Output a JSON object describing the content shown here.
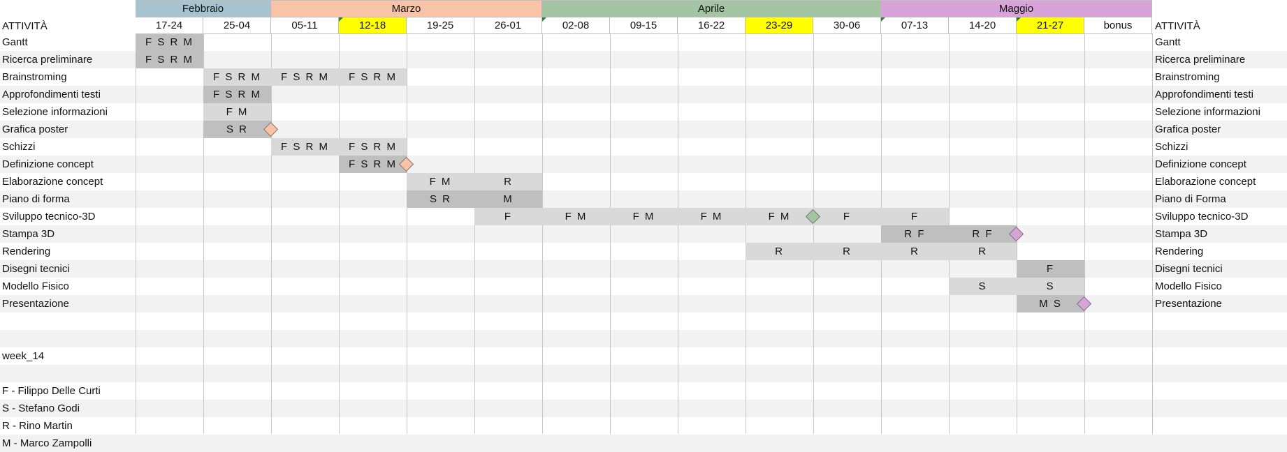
{
  "header_label": "ATTIVITÀ",
  "months": [
    {
      "name": "Febbraio",
      "color": "#a6c3cf",
      "start": 0,
      "span": 2
    },
    {
      "name": "Marzo",
      "color": "#f8c3a6",
      "start": 2,
      "span": 4
    },
    {
      "name": "Aprile",
      "color": "#a4c5a4",
      "start": 6,
      "span": 5
    },
    {
      "name": "Maggio",
      "color": "#d8a3d8",
      "start": 11,
      "span": 4
    }
  ],
  "weeks": [
    {
      "label": "17-24",
      "highlight": false,
      "flag": false
    },
    {
      "label": "25-04",
      "highlight": false,
      "flag": false
    },
    {
      "label": "05-11",
      "highlight": false,
      "flag": false
    },
    {
      "label": "12-18",
      "highlight": true,
      "flag": true
    },
    {
      "label": "19-25",
      "highlight": false,
      "flag": false
    },
    {
      "label": "26-01",
      "highlight": false,
      "flag": false
    },
    {
      "label": "02-08",
      "highlight": false,
      "flag": true
    },
    {
      "label": "09-15",
      "highlight": false,
      "flag": false
    },
    {
      "label": "16-22",
      "highlight": false,
      "flag": false
    },
    {
      "label": "23-29",
      "highlight": true,
      "flag": false
    },
    {
      "label": "30-06",
      "highlight": false,
      "flag": false
    },
    {
      "label": "07-13",
      "highlight": false,
      "flag": true
    },
    {
      "label": "14-20",
      "highlight": false,
      "flag": false
    },
    {
      "label": "21-27",
      "highlight": true,
      "flag": true
    },
    {
      "label": "bonus",
      "highlight": false,
      "flag": false
    }
  ],
  "colors": {
    "highlight": "#ffff00",
    "bar_light": "#d9d9d9",
    "bar_dark": "#bfbfbf",
    "flag": "#2e7d32"
  },
  "activities": [
    {
      "name": "Gantt",
      "right": "Gantt",
      "cells": [
        {
          "w": 0,
          "t": "FSRM",
          "shade": "dark"
        }
      ],
      "milestones": []
    },
    {
      "name": "Ricerca preliminare",
      "right": "Ricerca preliminare",
      "cells": [
        {
          "w": 0,
          "t": "FSRM",
          "shade": "dark"
        }
      ],
      "milestones": []
    },
    {
      "name": "Brainstroming",
      "right": "Brainstroming",
      "cells": [
        {
          "w": 1,
          "t": "FSRM",
          "shade": "light"
        },
        {
          "w": 2,
          "t": "FSRM",
          "shade": "light"
        },
        {
          "w": 3,
          "t": "FSRM",
          "shade": "light"
        }
      ],
      "milestones": []
    },
    {
      "name": "Approfondimenti testi",
      "right": "Approfondimenti testi",
      "cells": [
        {
          "w": 1,
          "t": "FSRM",
          "shade": "dark"
        }
      ],
      "milestones": []
    },
    {
      "name": "Selezione informazioni",
      "right": "Selezione informazioni",
      "cells": [
        {
          "w": 1,
          "t": "FM",
          "shade": "light"
        }
      ],
      "milestones": []
    },
    {
      "name": "Grafica poster",
      "right": "Grafica poster",
      "cells": [
        {
          "w": 1,
          "t": "SR",
          "shade": "dark"
        }
      ],
      "milestones": [
        {
          "w": 2,
          "color": "#f8c3a6"
        }
      ]
    },
    {
      "name": "Schizzi",
      "right": "Schizzi",
      "cells": [
        {
          "w": 2,
          "t": "FSRM",
          "shade": "light"
        },
        {
          "w": 3,
          "t": "FSRM",
          "shade": "light"
        }
      ],
      "milestones": []
    },
    {
      "name": "Definizione concept",
      "right": "Definizione concept",
      "cells": [
        {
          "w": 3,
          "t": "FSRM",
          "shade": "dark"
        }
      ],
      "milestones": [
        {
          "w": 4,
          "color": "#f8c3a6"
        }
      ]
    },
    {
      "name": "Elaborazione concept",
      "right": "Elaborazione concept",
      "cells": [
        {
          "w": 4,
          "t": "FM",
          "shade": "light"
        },
        {
          "w": 5,
          "t": "R",
          "shade": "light"
        }
      ],
      "milestones": []
    },
    {
      "name": "Piano di forma",
      "right": "Piano di Forma",
      "cells": [
        {
          "w": 4,
          "t": "SR",
          "shade": "dark"
        },
        {
          "w": 5,
          "t": "M",
          "shade": "dark"
        }
      ],
      "milestones": []
    },
    {
      "name": "Sviluppo tecnico-3D",
      "right": "Sviluppo tecnico-3D",
      "cells": [
        {
          "w": 5,
          "t": "F",
          "shade": "light"
        },
        {
          "w": 6,
          "t": "FM",
          "shade": "light"
        },
        {
          "w": 7,
          "t": "FM",
          "shade": "light"
        },
        {
          "w": 8,
          "t": "FM",
          "shade": "light"
        },
        {
          "w": 9,
          "t": "FM",
          "shade": "light"
        },
        {
          "w": 10,
          "t": "F",
          "shade": "light"
        },
        {
          "w": 11,
          "t": "F",
          "shade": "light"
        }
      ],
      "milestones": [
        {
          "w": 10,
          "color": "#a4c5a4"
        }
      ]
    },
    {
      "name": "Stampa 3D",
      "right": "Stampa 3D",
      "cells": [
        {
          "w": 11,
          "t": "RF",
          "shade": "dark"
        },
        {
          "w": 12,
          "t": "RF",
          "shade": "dark"
        }
      ],
      "milestones": [
        {
          "w": 13,
          "color": "#d8a3d8"
        }
      ]
    },
    {
      "name": "Rendering",
      "right": "Rendering",
      "cells": [
        {
          "w": 9,
          "t": "R",
          "shade": "light"
        },
        {
          "w": 10,
          "t": "R",
          "shade": "light"
        },
        {
          "w": 11,
          "t": "R",
          "shade": "light"
        },
        {
          "w": 12,
          "t": "R",
          "shade": "light"
        }
      ],
      "milestones": []
    },
    {
      "name": "Disegni tecnici",
      "right": "Disegni tecnici",
      "cells": [
        {
          "w": 13,
          "t": "F",
          "shade": "dark"
        }
      ],
      "milestones": []
    },
    {
      "name": "Modello Fisico",
      "right": "Modello Fisico",
      "cells": [
        {
          "w": 12,
          "t": "S",
          "shade": "light"
        },
        {
          "w": 13,
          "t": "S",
          "shade": "light"
        }
      ],
      "milestones": []
    },
    {
      "name": "Presentazione",
      "right": "Presentazione",
      "cells": [
        {
          "w": 13,
          "t": "MS",
          "shade": "dark"
        }
      ],
      "milestones": [
        {
          "w": 14,
          "color": "#d8a3d8"
        }
      ]
    }
  ],
  "extra_rows": [
    {
      "row": 17,
      "text": ""
    },
    {
      "row": 18,
      "text": "week_14"
    },
    {
      "row": 19,
      "text": ""
    },
    {
      "row": 20,
      "text": "F - Filippo Delle Curti"
    },
    {
      "row": 21,
      "text": "S - Stefano Godi"
    },
    {
      "row": 22,
      "text": "R - Rino Martin"
    },
    {
      "row": 23,
      "text": "M - Marco Zampolli"
    }
  ]
}
